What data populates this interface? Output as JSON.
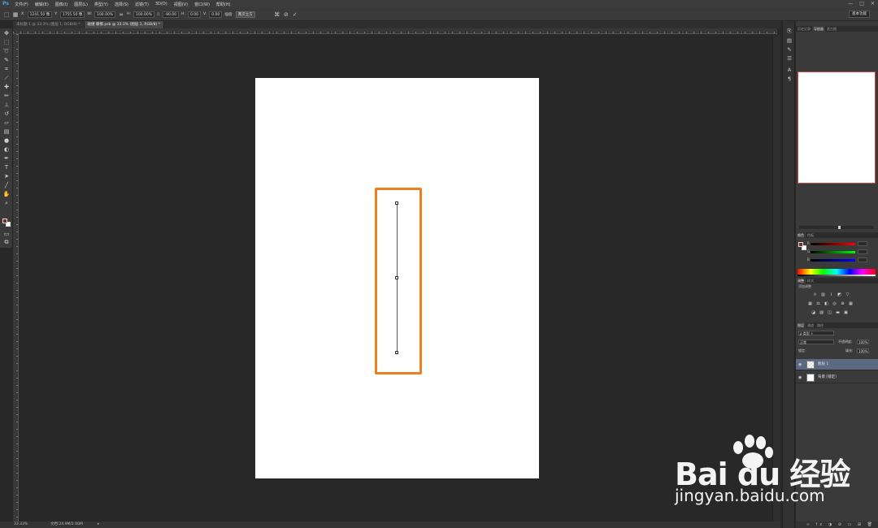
{
  "menubar": {
    "logo": "Ps",
    "items": [
      "文件(F)",
      "编辑(E)",
      "图像(I)",
      "图层(L)",
      "类型(Y)",
      "选择(S)",
      "滤镜(T)",
      "3D(D)",
      "视图(V)",
      "窗口(W)",
      "帮助(H)"
    ],
    "window_buttons": [
      "—",
      "□",
      "✕"
    ]
  },
  "optionsbar": {
    "x_label": "X:",
    "x_value": "1241.50 像",
    "y_label": "Y:",
    "y_value": "1755.50 像",
    "w_label": "W:",
    "w_value": "100.00%",
    "h_label": "H:",
    "h_value": "100.00%",
    "angle_label": "△",
    "angle_value": "-90.00",
    "hskew_label": "H:",
    "hskew_value": "0.00",
    "vskew_label": "V:",
    "vskew_value": "0.00",
    "interp_label": "插值:",
    "interp_value": "两次立方",
    "workspace": "基本功能"
  },
  "tabs": [
    {
      "label": "未标题-1 @ 33.3% (图层 1, RGB/8) *",
      "active": false
    },
    {
      "label": "碰撞 摩擦.psb @ 33.3% (图层 1, RGB/8) *",
      "active": true
    }
  ],
  "statusbar": {
    "zoom": "33.33%",
    "doc": "文档:24.9M/2.00M"
  },
  "panels": {
    "nav_tabs": [
      "历史记录",
      "导航器",
      "直方图"
    ],
    "color_tabs": [
      "颜色",
      "色板"
    ],
    "color_labels": [
      "R",
      "G",
      "B"
    ],
    "adj_tabs": [
      "调整",
      "样式"
    ],
    "adj_title": "添加调整",
    "layers_tabs": [
      "图层",
      "通道",
      "路径"
    ],
    "blend_mode": "正常",
    "opacity_label": "不透明度:",
    "opacity_value": "100%",
    "lock_label": "锁定:",
    "fill_label": "填充:",
    "fill_value": "100%",
    "layers": [
      {
        "name": "图层 1",
        "selected": true
      },
      {
        "name": "背景 [锁定]",
        "selected": false
      }
    ]
  },
  "watermark": {
    "brand": "Bai du 经验",
    "url": "jingyan.baidu.com"
  },
  "colors": {
    "highlight": "#ee7e1e",
    "foreground_swatch": "#7a2b20",
    "document": "#ffffff"
  }
}
